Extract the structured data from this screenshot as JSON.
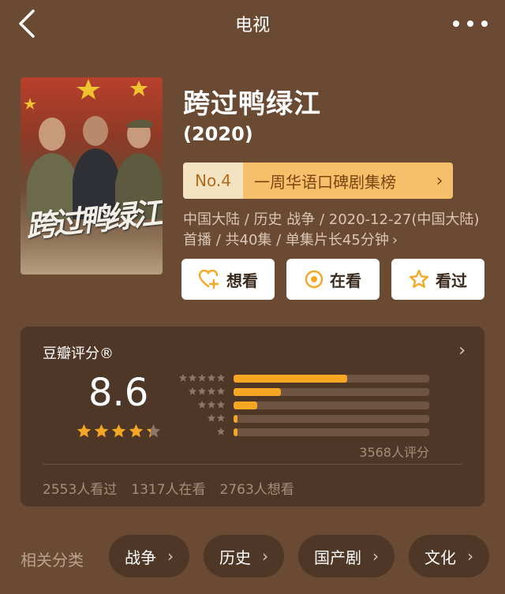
{
  "header": {
    "title": "电视"
  },
  "show": {
    "title": "跨过鸭绿江",
    "year": "(2020)",
    "poster_title": "跨过鸭绿江",
    "rank": {
      "no": "No.4",
      "text": "一周华语口碑剧集榜",
      "chevron": "›"
    },
    "meta": "中国大陆 / 历史 战争 / 2020-12-27(中国大陆)首播 / 共40集 / 单集片长45分钟",
    "meta_chevron": "›"
  },
  "actions": [
    {
      "label": "想看",
      "icon": "heart-plus-icon"
    },
    {
      "label": "在看",
      "icon": "circle-dot-icon"
    },
    {
      "label": "看过",
      "icon": "star-outline-icon"
    }
  ],
  "rating": {
    "title": "豆瓣评分®",
    "chevron": "›",
    "score": "8.6",
    "stars_value": 4.3,
    "distribution": [
      {
        "stars": 5,
        "fraction": 0.58
      },
      {
        "stars": 4,
        "fraction": 0.24
      },
      {
        "stars": 3,
        "fraction": 0.12
      },
      {
        "stars": 2,
        "fraction": 0.02
      },
      {
        "stars": 1,
        "fraction": 0.02
      }
    ],
    "count_text": "3568人评分",
    "stats": [
      "2553人看过",
      "1317人在看",
      "2763人想看"
    ]
  },
  "related": {
    "label": "相关分类",
    "chips": [
      "战争",
      "历史",
      "国产剧",
      "文化"
    ],
    "chevron": "›"
  },
  "colors": {
    "background": "#6a4a33",
    "card": "#4e3726",
    "accent": "#f5a623",
    "star_gray": "#8c7766"
  }
}
